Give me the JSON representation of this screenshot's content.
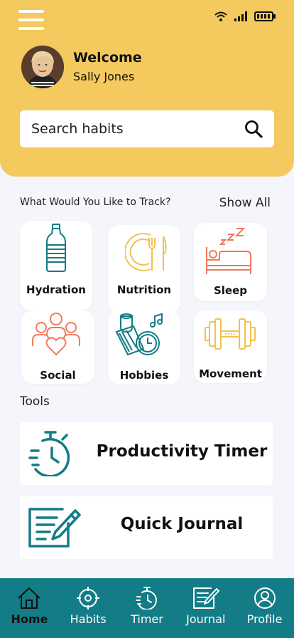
{
  "header": {
    "welcome": "Welcome",
    "user_name": "Sally Jones"
  },
  "search": {
    "placeholder": "Search habits"
  },
  "track": {
    "heading": "What Would You Like to Track?",
    "show_all": "Show All",
    "categories": [
      {
        "label": "Hydration",
        "icon": "water-bottle-icon"
      },
      {
        "label": "Nutrition",
        "icon": "plate-fork-knife-icon"
      },
      {
        "label": "Sleep",
        "icon": "bed-zzz-icon"
      },
      {
        "label": "Social",
        "icon": "people-heart-icon"
      },
      {
        "label": "Hobbies",
        "icon": "book-coffee-music-icon"
      },
      {
        "label": "Movement",
        "icon": "dumbbell-icon"
      }
    ]
  },
  "tools": {
    "heading": "Tools",
    "items": [
      {
        "label": "Productivity Timer",
        "icon": "stopwatch-icon"
      },
      {
        "label": "Quick Journal",
        "icon": "journal-pen-icon"
      }
    ]
  },
  "nav": {
    "items": [
      {
        "label": "Home",
        "icon": "home-icon",
        "active": true
      },
      {
        "label": "Habits",
        "icon": "target-icon",
        "active": false
      },
      {
        "label": "Timer",
        "icon": "timer-icon",
        "active": false
      },
      {
        "label": "Journal",
        "icon": "journal-icon",
        "active": false
      },
      {
        "label": "Profile",
        "icon": "profile-icon",
        "active": false
      }
    ]
  },
  "colors": {
    "header_bg": "#f4c95d",
    "teal": "#137c86",
    "coral": "#f07a5a",
    "yellow": "#f2c14e",
    "page_bg": "#f4f6fb"
  }
}
